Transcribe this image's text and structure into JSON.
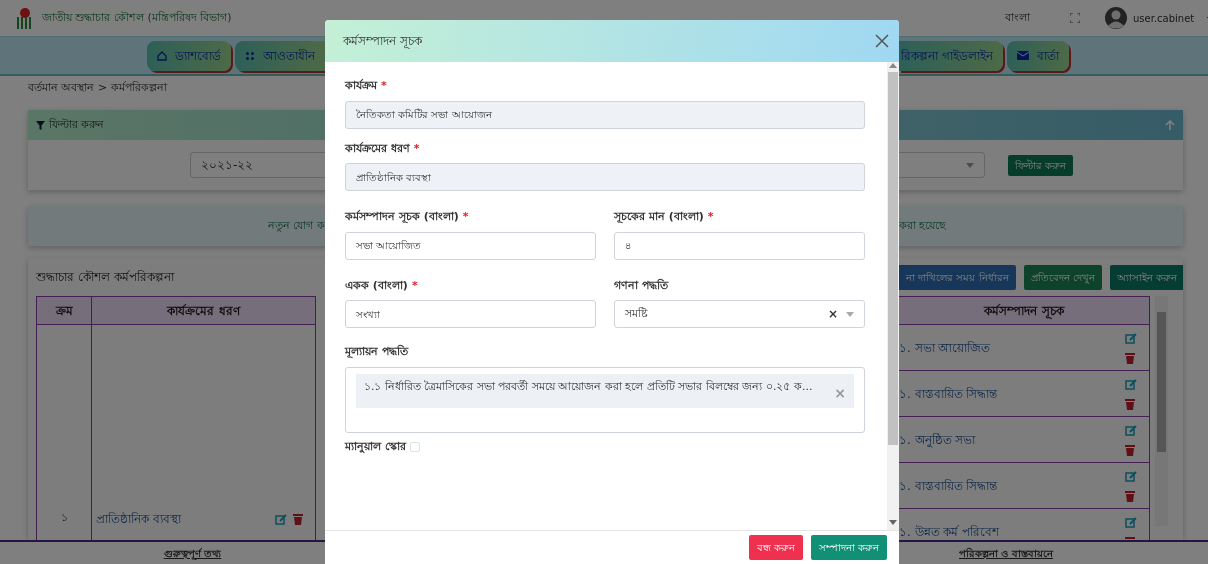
{
  "header": {
    "title": "জাতীয় শুদ্ধাচার কৌশল (মন্ত্রিপরিষদ বিভাগ)",
    "language": "বাংলা",
    "user": "user.cabinet"
  },
  "nav_left": [
    {
      "label": "ড্যাশবোর্ড",
      "kind": "home"
    },
    {
      "label": "আওতাধীন",
      "kind": "grid"
    }
  ],
  "nav_right": [
    {
      "label": "রিকল্পনা গাইডলাইন",
      "kind": "plain"
    },
    {
      "label": "বার্তা",
      "kind": "mail"
    }
  ],
  "breadcrumb": "বর্তমান অবস্থান > কর্মপরিকল্পনা",
  "filter": {
    "title": "ফিল্টার করুন",
    "year": "২০২১-২২",
    "button": "ফিল্টার করুন"
  },
  "notice": {
    "left": "নতুন যোগ ক",
    "right": "করা হয়েছে"
  },
  "plan": {
    "title": "শুদ্ধাচার কৌশল কর্মপরিকল্পনা",
    "buttons": [
      {
        "label": "না দাখিলের সময় নির্ধারন",
        "kind": "primary"
      },
      {
        "label": "প্রতিবেদন দেখুন",
        "kind": "success"
      },
      {
        "label": "অ্যাসাইন করুন",
        "kind": "teal"
      }
    ],
    "columns": [
      "ক্রম",
      "কার্যক্রমের ধরণ"
    ],
    "row": {
      "serial": "১",
      "type": "প্রাতিষ্ঠানিক ব্যবস্থা"
    },
    "indicator_column": "কর্মসম্পাদন সূচক",
    "indicators": [
      "১. সভা আয়োজিত",
      "১. বাস্তবায়িত সিদ্ধান্ত",
      "১. অনুষ্ঠিত সভা",
      "১. বাস্তবায়িত সিদ্ধান্ত",
      "১. উন্নত কর্ম পরিবেশ"
    ]
  },
  "footer": [
    "গুরুত্বপূর্ণ তথ্য",
    "পরিকল্পনা ও বাস্তবায়নে"
  ],
  "modal": {
    "title": "কর্মসম্পাদন সূচক",
    "required_mark": "*",
    "fields": [
      {
        "label": "কার্যক্রম",
        "required": true,
        "value": "নৈতিকতা কমিটির সভা আয়োজন",
        "kind": "readonly"
      },
      {
        "label": "কার্যক্রমের ধরণ",
        "required": true,
        "value": "প্রাতিষ্ঠানিক ব্যবস্থা",
        "kind": "readonly"
      },
      {
        "label": "কর্মসম্পাদন সূচক (বাংলা)",
        "required": true,
        "value": "সভা আয়োজিত",
        "kind": "text"
      },
      {
        "label": "সূচকের মান (বাংলা)",
        "required": true,
        "value": "৪",
        "kind": "text"
      },
      {
        "label": "একক (বাংলা)",
        "required": true,
        "value": "সংখ্যা",
        "kind": "text"
      },
      {
        "label": "গণনা পদ্ধতি",
        "required": false,
        "value": "সমষ্টি",
        "kind": "select",
        "clear": "×"
      }
    ],
    "evaluation": {
      "label": "মূল্যায়ন পদ্ধতি",
      "tag": "১.১ নির্ধারিত ত্রৈমাসিকের সভা পরবর্তী সময়ে আয়োজন করা হলে প্রতিটি সভার বিলম্বের জন্য ০.২৫ ক...",
      "remove": "×"
    },
    "manual_score": {
      "label": "ম্যানুয়াল স্কোর",
      "checked": false
    },
    "buttons": [
      {
        "label": "বন্ধ করুন",
        "kind": "danger"
      },
      {
        "label": "সম্পাদনা করুন",
        "kind": "success"
      }
    ]
  }
}
